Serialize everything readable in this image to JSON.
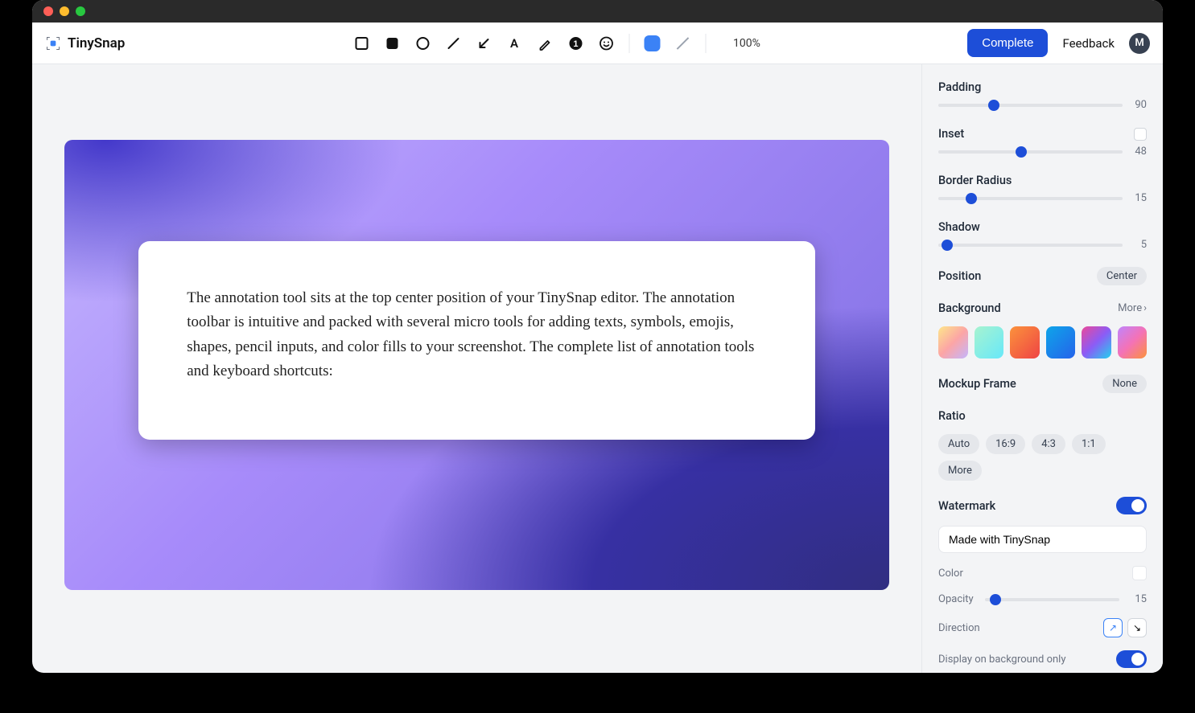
{
  "app": {
    "name": "TinySnap",
    "avatar_initial": "M"
  },
  "toolbar": {
    "zoom": "100%",
    "complete_button": "Complete",
    "feedback_link": "Feedback",
    "tools": [
      "rectangle",
      "filled-rectangle",
      "circle",
      "line",
      "arrow",
      "text",
      "pencil",
      "number",
      "emoji"
    ],
    "fill_color": "#3b82f6"
  },
  "canvas": {
    "content_text": "The annotation tool sits at the top center position of your TinySnap editor. The annotation toolbar is intuitive and packed with several micro tools for adding texts, symbols, emojis, shapes, pencil inputs, and color fills to your screenshot. The complete list of annotation tools and keyboard shortcuts:"
  },
  "sidebar": {
    "padding": {
      "label": "Padding",
      "value": "90",
      "pct": 30
    },
    "inset": {
      "label": "Inset",
      "value": "48",
      "pct": 45
    },
    "border_radius": {
      "label": "Border Radius",
      "value": "15",
      "pct": 18
    },
    "shadow": {
      "label": "Shadow",
      "value": "5",
      "pct": 5
    },
    "position": {
      "label": "Position",
      "value": "Center"
    },
    "background": {
      "label": "Background",
      "more": "More"
    },
    "mockup_frame": {
      "label": "Mockup Frame",
      "value": "None"
    },
    "ratio": {
      "label": "Ratio",
      "options": [
        "Auto",
        "16:9",
        "4:3",
        "1:1",
        "More"
      ]
    },
    "watermark": {
      "label": "Watermark",
      "text_value": "Made with TinySnap",
      "color_label": "Color",
      "opacity_label": "Opacity",
      "opacity_value": "15",
      "opacity_pct": 8,
      "direction_label": "Direction",
      "display_bg_only_label": "Display on background only"
    }
  }
}
